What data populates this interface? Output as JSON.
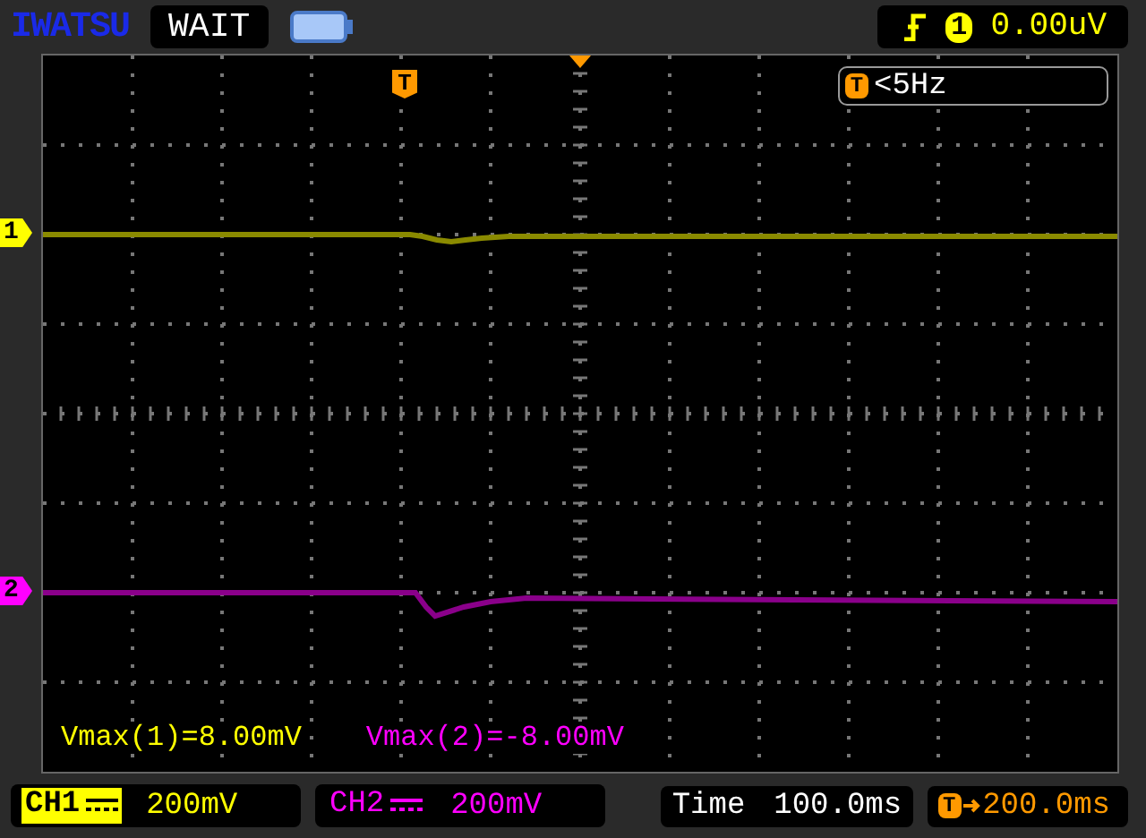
{
  "brand": "IWATSU",
  "run_status": "WAIT",
  "trigger": {
    "source": "1",
    "level": "0.00uV",
    "marker": "T",
    "frequency_badge": "T",
    "frequency": "<5Hz"
  },
  "channels": [
    {
      "marker": "1",
      "color": "#ffff00"
    },
    {
      "marker": "2",
      "color": "#ff00ff"
    }
  ],
  "measurements": [
    {
      "text": "Vmax(1)=8.00mV",
      "color": "#ffff00"
    },
    {
      "text": "Vmax(2)=-8.00mV",
      "color": "#ff00ff"
    }
  ],
  "status_bar": {
    "channels": [
      {
        "name": "CH1",
        "scale": "200mV",
        "selected": true,
        "color": "#ffff00"
      },
      {
        "name": "CH2",
        "scale": "200mV",
        "selected": false,
        "color": "#ff00ff"
      }
    ],
    "time_label": "Time",
    "timebase": "100.0ms",
    "position_badge": "T",
    "position": "200.0ms"
  }
}
